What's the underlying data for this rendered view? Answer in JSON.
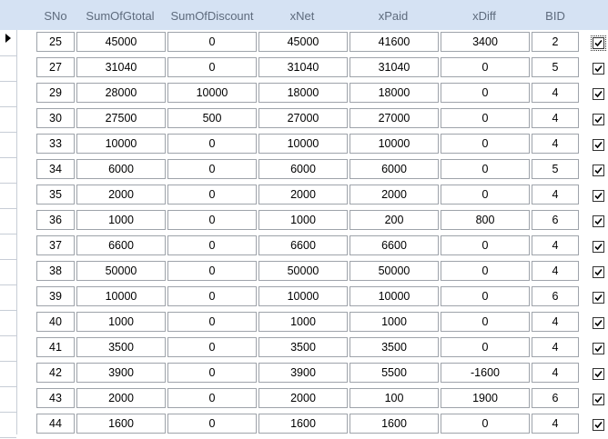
{
  "columns": [
    "SNo",
    "SumOfGtotal",
    "SumOfDiscount",
    "xNet",
    "xPaid",
    "xDiff",
    "BID"
  ],
  "rows": [
    {
      "SNo": "25",
      "SumOfGtotal": "45000",
      "SumOfDiscount": "0",
      "xNet": "45000",
      "xPaid": "41600",
      "xDiff": "3400",
      "BID": "2",
      "checked": true,
      "current": true
    },
    {
      "SNo": "27",
      "SumOfGtotal": "31040",
      "SumOfDiscount": "0",
      "xNet": "31040",
      "xPaid": "31040",
      "xDiff": "0",
      "BID": "5",
      "checked": true,
      "current": false
    },
    {
      "SNo": "29",
      "SumOfGtotal": "28000",
      "SumOfDiscount": "10000",
      "xNet": "18000",
      "xPaid": "18000",
      "xDiff": "0",
      "BID": "4",
      "checked": true,
      "current": false
    },
    {
      "SNo": "30",
      "SumOfGtotal": "27500",
      "SumOfDiscount": "500",
      "xNet": "27000",
      "xPaid": "27000",
      "xDiff": "0",
      "BID": "4",
      "checked": true,
      "current": false
    },
    {
      "SNo": "33",
      "SumOfGtotal": "10000",
      "SumOfDiscount": "0",
      "xNet": "10000",
      "xPaid": "10000",
      "xDiff": "0",
      "BID": "4",
      "checked": true,
      "current": false
    },
    {
      "SNo": "34",
      "SumOfGtotal": "6000",
      "SumOfDiscount": "0",
      "xNet": "6000",
      "xPaid": "6000",
      "xDiff": "0",
      "BID": "5",
      "checked": true,
      "current": false
    },
    {
      "SNo": "35",
      "SumOfGtotal": "2000",
      "SumOfDiscount": "0",
      "xNet": "2000",
      "xPaid": "2000",
      "xDiff": "0",
      "BID": "4",
      "checked": true,
      "current": false
    },
    {
      "SNo": "36",
      "SumOfGtotal": "1000",
      "SumOfDiscount": "0",
      "xNet": "1000",
      "xPaid": "200",
      "xDiff": "800",
      "BID": "6",
      "checked": true,
      "current": false
    },
    {
      "SNo": "37",
      "SumOfGtotal": "6600",
      "SumOfDiscount": "0",
      "xNet": "6600",
      "xPaid": "6600",
      "xDiff": "0",
      "BID": "4",
      "checked": true,
      "current": false
    },
    {
      "SNo": "38",
      "SumOfGtotal": "50000",
      "SumOfDiscount": "0",
      "xNet": "50000",
      "xPaid": "50000",
      "xDiff": "0",
      "BID": "4",
      "checked": true,
      "current": false
    },
    {
      "SNo": "39",
      "SumOfGtotal": "10000",
      "SumOfDiscount": "0",
      "xNet": "10000",
      "xPaid": "10000",
      "xDiff": "0",
      "BID": "6",
      "checked": true,
      "current": false
    },
    {
      "SNo": "40",
      "SumOfGtotal": "1000",
      "SumOfDiscount": "0",
      "xNet": "1000",
      "xPaid": "1000",
      "xDiff": "0",
      "BID": "4",
      "checked": true,
      "current": false
    },
    {
      "SNo": "41",
      "SumOfGtotal": "3500",
      "SumOfDiscount": "0",
      "xNet": "3500",
      "xPaid": "3500",
      "xDiff": "0",
      "BID": "4",
      "checked": true,
      "current": false
    },
    {
      "SNo": "42",
      "SumOfGtotal": "3900",
      "SumOfDiscount": "0",
      "xNet": "3900",
      "xPaid": "5500",
      "xDiff": "-1600",
      "BID": "4",
      "checked": true,
      "current": false
    },
    {
      "SNo": "43",
      "SumOfGtotal": "2000",
      "SumOfDiscount": "0",
      "xNet": "2000",
      "xPaid": "100",
      "xDiff": "1900",
      "BID": "6",
      "checked": true,
      "current": false
    },
    {
      "SNo": "44",
      "SumOfGtotal": "1600",
      "SumOfDiscount": "0",
      "xNet": "1600",
      "xPaid": "1600",
      "xDiff": "0",
      "BID": "4",
      "checked": true,
      "current": false
    }
  ],
  "colors": {
    "header_bg": "#d5e2f3",
    "header_text": "#5e6b7d",
    "cell_border": "#9ea3aa"
  },
  "icons": {
    "record_selector": "current-record-arrow-icon",
    "checkbox": "checkmark-icon"
  }
}
